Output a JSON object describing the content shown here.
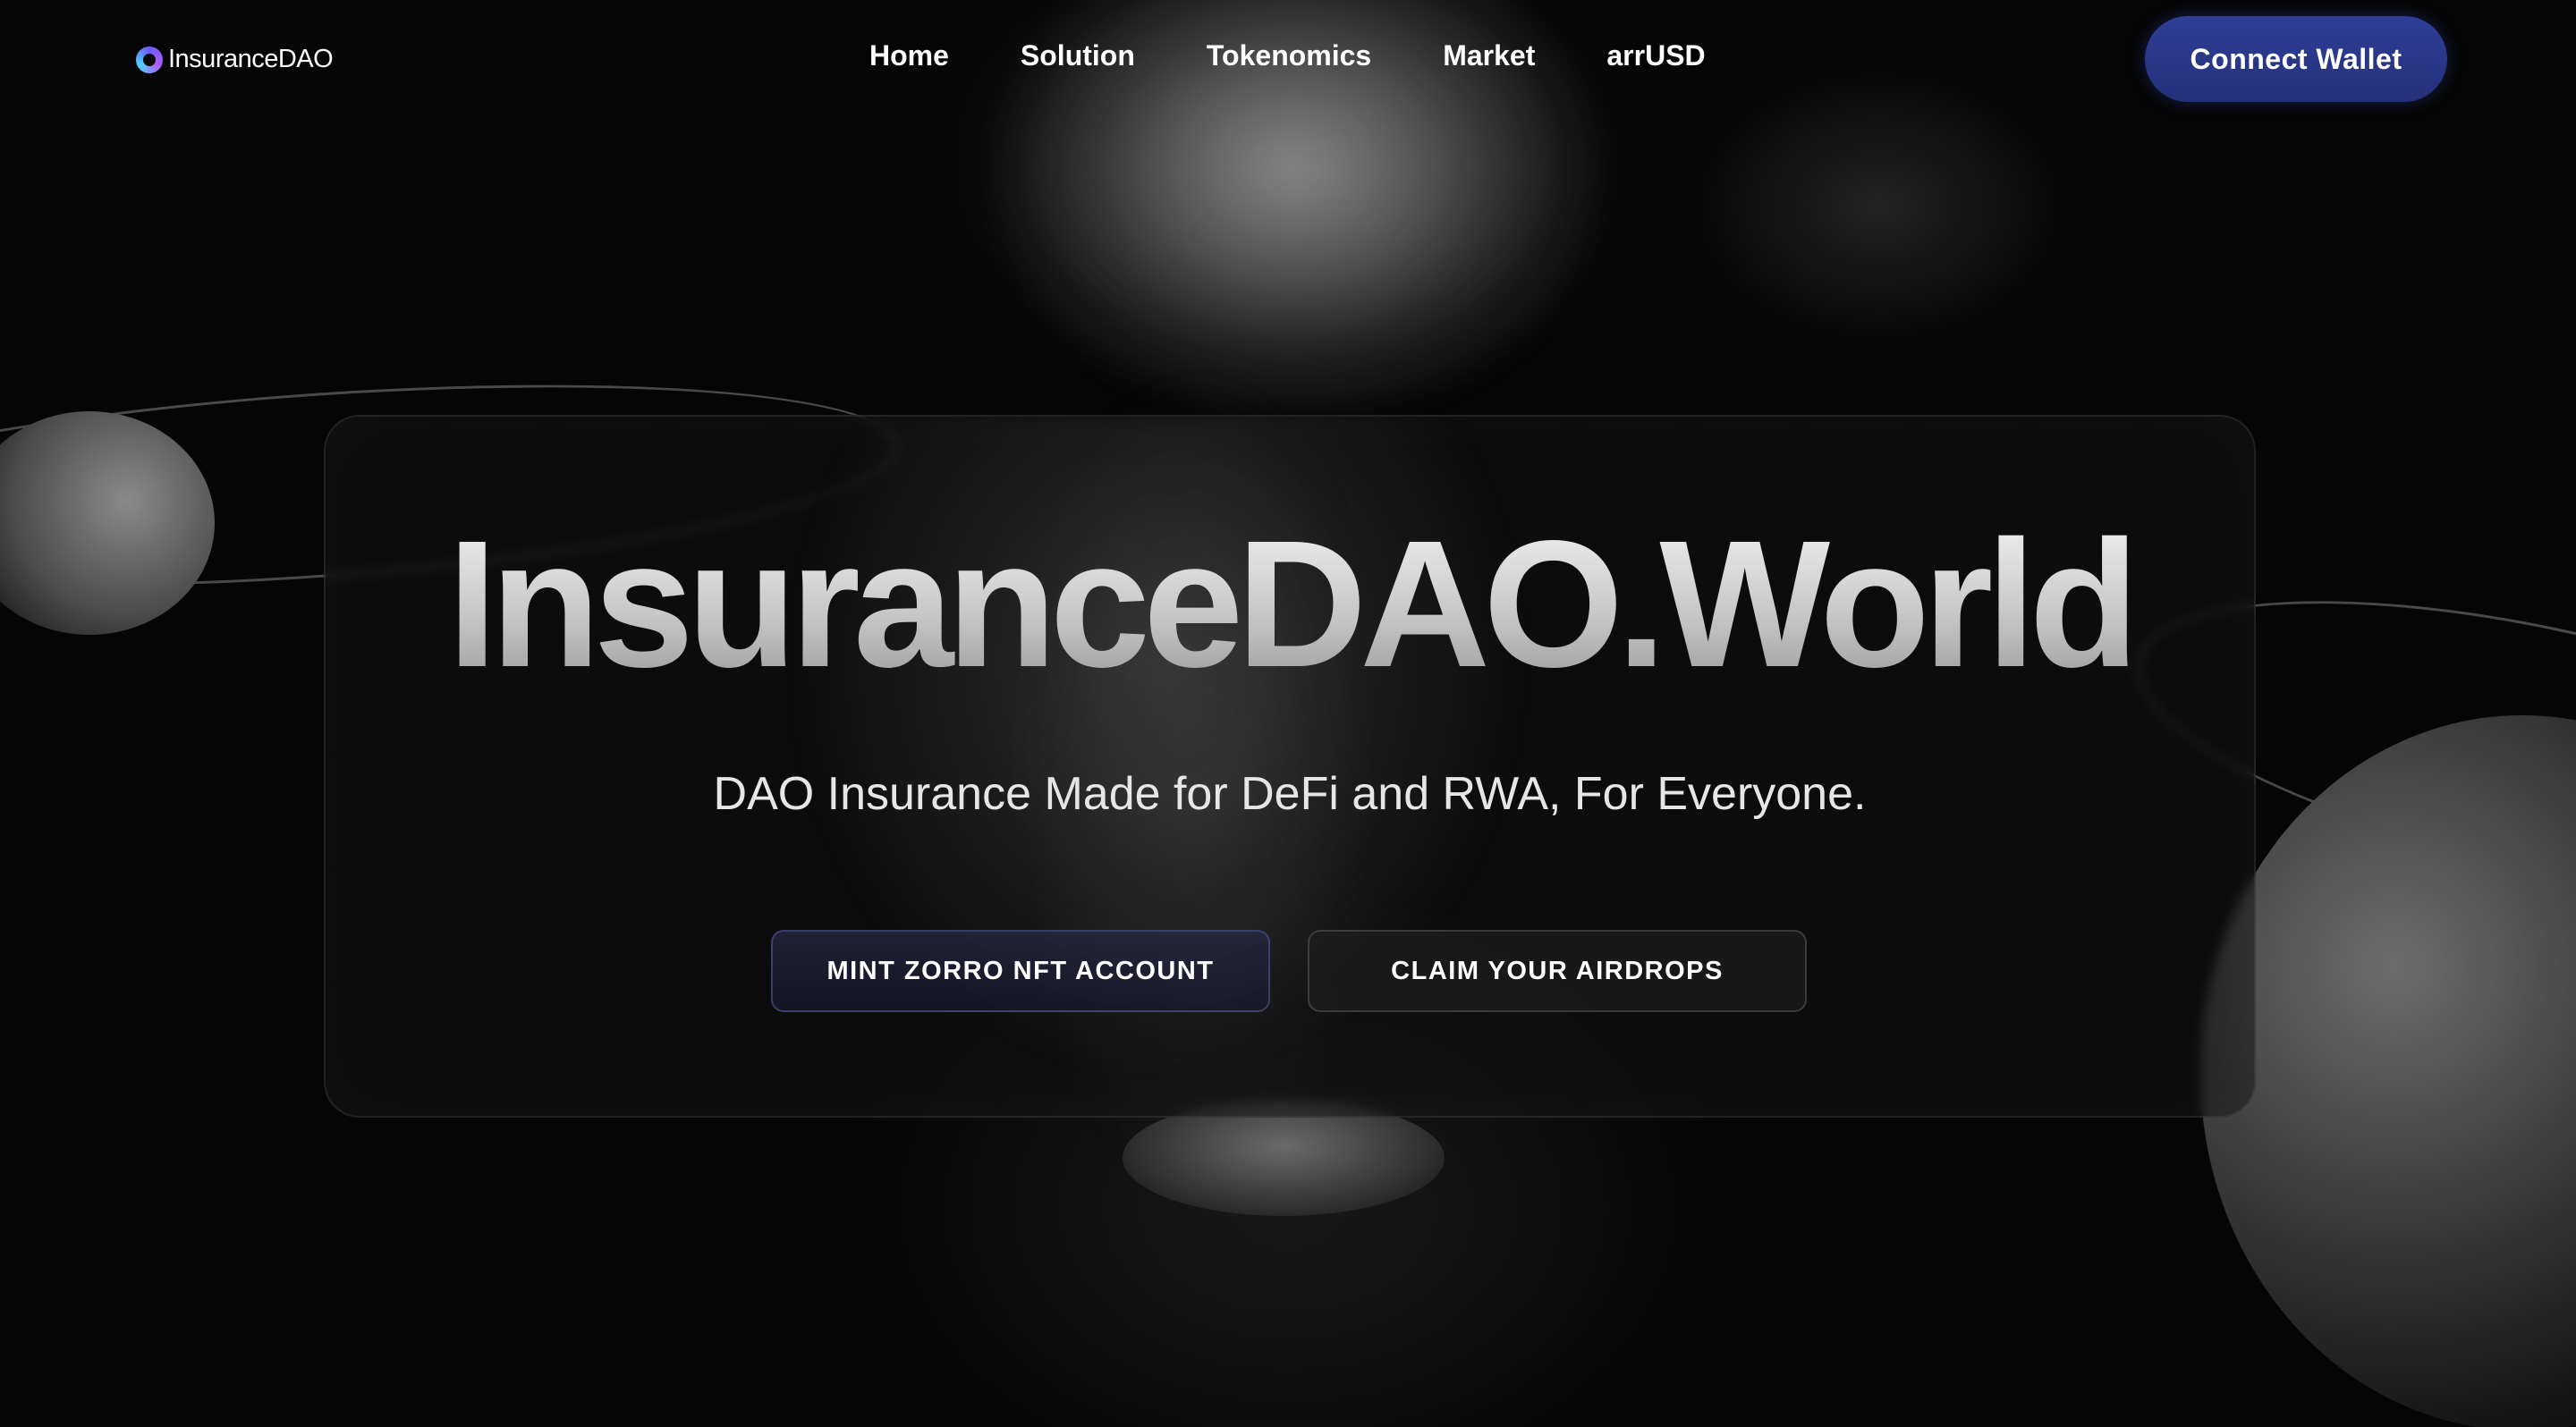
{
  "nav": {
    "logo_text": "InsuranceDAO",
    "links": [
      {
        "label": "Home"
      },
      {
        "label": "Solution"
      },
      {
        "label": "Tokenomics"
      },
      {
        "label": "Market"
      },
      {
        "label": "arrUSD"
      }
    ],
    "connect_label": "Connect Wallet"
  },
  "hero": {
    "title": "InsuranceDAO.World",
    "subtitle": "DAO Insurance Made for DeFi and RWA, For Everyone.",
    "primary_button": "MINT ZORRO NFT ACCOUNT",
    "secondary_button": "CLAIM YOUR AIRDROPS"
  },
  "colors": {
    "background": "#050505",
    "connect_button": "#2a3784",
    "text": "#ffffff"
  },
  "icons": {
    "logo": "insurancedao-logo-icon"
  }
}
